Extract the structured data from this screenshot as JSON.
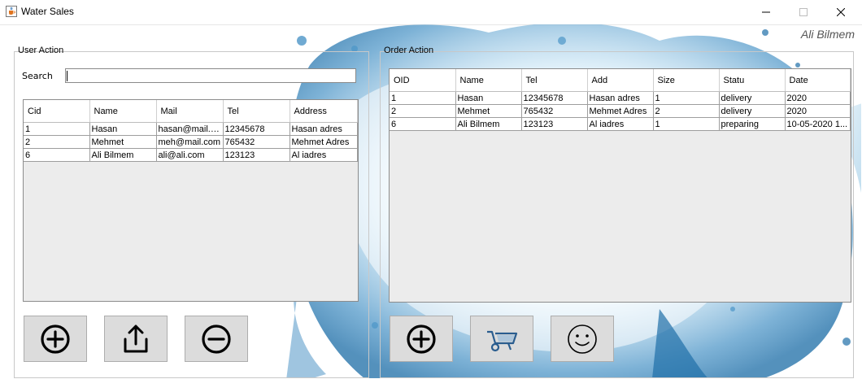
{
  "window": {
    "title": "Water Sales",
    "app_icon": "java-cup-icon",
    "controls": [
      "minimize-icon",
      "maximize-icon",
      "close-icon"
    ]
  },
  "current_user": "Ali Bilmem",
  "user_panel": {
    "title": "User Action",
    "search_label": "Search",
    "search_value": "",
    "columns": [
      "Cid",
      "Name",
      "Mail",
      "Tel",
      "Address"
    ],
    "rows": [
      [
        "1",
        "Hasan",
        "hasan@mail.com",
        "12345678",
        "Hasan adres"
      ],
      [
        "2",
        "Mehmet",
        "meh@mail.com",
        "765432",
        "Mehmet Adres"
      ],
      [
        "6",
        "Ali Bilmem",
        "ali@ali.com",
        "123123",
        "Al iadres"
      ]
    ],
    "buttons": [
      "add-circle-icon",
      "share-upload-icon",
      "remove-circle-icon"
    ]
  },
  "order_panel": {
    "title": "Order Action",
    "columns": [
      "OID",
      "Name",
      "Tel",
      "Add",
      "Size",
      "Statu",
      "Date"
    ],
    "rows": [
      [
        "1",
        "Hasan",
        "12345678",
        "Hasan adres",
        "1",
        "delivery",
        "2020"
      ],
      [
        "2",
        "Mehmet",
        "765432",
        "Mehmet Adres",
        "2",
        "delivery",
        "2020"
      ],
      [
        "6",
        "Ali Bilmem",
        "123123",
        "Al iadres",
        "1",
        "preparing",
        "10-05-2020 1..."
      ]
    ],
    "buttons": [
      "add-circle-icon",
      "wheelbarrow-icon",
      "smiley-icon"
    ]
  },
  "colors": {
    "water_dark": "#1f6fa8",
    "water_light": "#a9d3ec",
    "button_bg": "#dcdcdc",
    "table_empty_bg": "#ececec"
  }
}
